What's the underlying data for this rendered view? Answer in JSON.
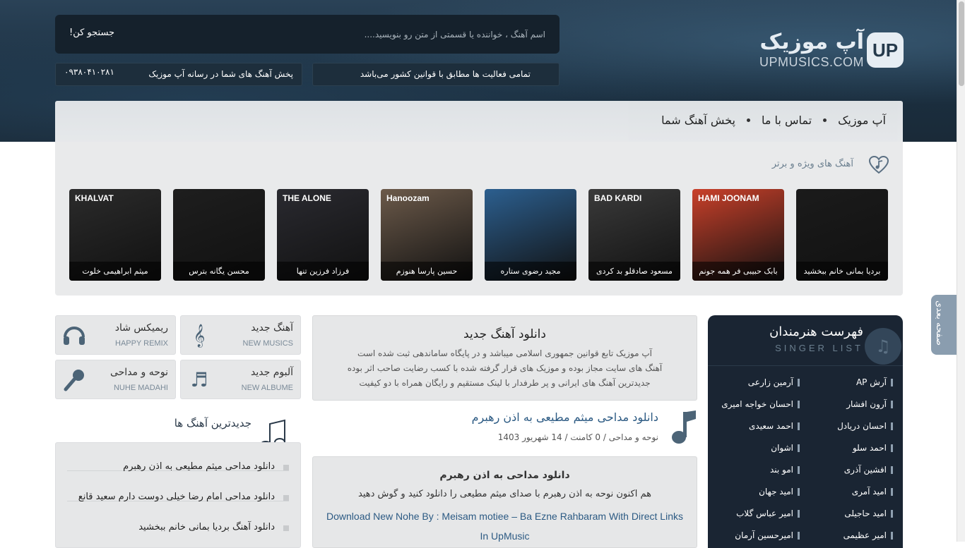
{
  "header": {
    "logo_fa": "آپ موزیک",
    "logo_en": "UPMUSICS.COM",
    "logo_mark": "UP",
    "search_placeholder": "اسم آهنگ ، خواننده یا قسمتی از متن رو بنویسید....",
    "search_button": "جستجو کن!",
    "notice": "تمامی فعالیت ها مطابق با قوانین کشور می‌باشد",
    "promo": "پخش آهنگ های شما در رسانه آپ موزیک",
    "phone": "۰۹۳۸۰۴۱۰۲۸۱"
  },
  "nav": {
    "items": [
      "آپ موزیک",
      "تماس با ما",
      "پخش آهنگ شما"
    ]
  },
  "featured": {
    "title": "آهنگ های ویژه و برتر",
    "cards": [
      {
        "caption": "بردیا بمانی خانم ببخشید",
        "bg": "#1b1b1b",
        "tag": ""
      },
      {
        "caption": "بابک حبیبی فر همه جونم",
        "bg": "#c9402a",
        "tag": "HAMI JOONAM"
      },
      {
        "caption": "مسعود صادقلو بد کردی",
        "bg": "#3a3a3a",
        "tag": "BAD KARDI"
      },
      {
        "caption": "مجید رضوی ستاره",
        "bg": "#2c5f8f",
        "tag": ""
      },
      {
        "caption": "حسین پارسا هنوزم",
        "bg": "#6c5a4a",
        "tag": "Hanoozam"
      },
      {
        "caption": "فرزاد فرزین تنها",
        "bg": "#2a2a30",
        "tag": "THE ALONE"
      },
      {
        "caption": "محسن یگانه بترس",
        "bg": "#1e1e1e",
        "tag": ""
      },
      {
        "caption": "میثم ابراهیمی خلوت",
        "bg": "#2b2b2b",
        "tag": "KHALVAT"
      }
    ]
  },
  "singers": {
    "title": "فهرست هنرمندان",
    "subtitle": "SINGER LIST",
    "items": [
      "آرش AP",
      "آرمین زارعی",
      "آرون افشار",
      "احسان خواجه امیری",
      "احسان دریادل",
      "احمد سعیدی",
      "احمد سلو",
      "اشوان",
      "افشین آذری",
      "امو بند",
      "امید آمری",
      "امید جهان",
      "امید حاجیلی",
      "امیر عباس گلاب",
      "امیر عظیمی",
      "امیرحسین آرمان"
    ]
  },
  "side_tab": "صفحه بعدی",
  "intro": {
    "title": "دانلود آهنگ جدید",
    "lines": [
      "آپ موزیک تابع قوانین جمهوری اسلامی میباشد و در پایگاه ساماندهی ثبت شده است",
      "آهنگ های سایت مجاز بوده و موزیک های قرار گرفته شده با کسب رضایت صاحب اثر بوده",
      "جدیدترین آهنگ های ایرانی و پر طرفدار با لینک مستقیم و رایگان همراه با دو کیفیت"
    ]
  },
  "post": {
    "title": "دانلود مداحی میثم مطیعی به اذن رهبرم",
    "meta": "نوحه و مداحی  /  0 کامنت  /  14 شهریور 1403",
    "body_title": "دانلود مداحی به اذن رهبرم",
    "body_text": "هم اکنون نوحه به اذن رهبرم با صدای میثم مطیعی را دانلود کنید و گوش دهید",
    "body_en": "Download New Nohe By : Meisam motiee – Ba Ezne Rahbaram With Direct Links In UpMusic"
  },
  "categories": [
    {
      "fa": "آهنگ جدید",
      "en": "NEW MUSICS",
      "icon": "music-clef-icon"
    },
    {
      "fa": "ریمیکس شاد",
      "en": "HAPPY REMIX",
      "icon": "headphones-icon"
    },
    {
      "fa": "آلبوم جدید",
      "en": "NEW ALBUME",
      "icon": "album-notes-icon"
    },
    {
      "fa": "نوحه و مداحی",
      "en": "NUHE MADAHI",
      "icon": "microphone-icon"
    }
  ],
  "latest": {
    "title": "جدیدترین آهنگ ها",
    "items": [
      "دانلود مداحی میثم مطیعی به اذن رهبرم",
      "دانلود مداحی امام رضا خیلی دوست دارم سعید قانع",
      "دانلود آهنگ بردیا بمانی خانم ببخشید"
    ]
  }
}
